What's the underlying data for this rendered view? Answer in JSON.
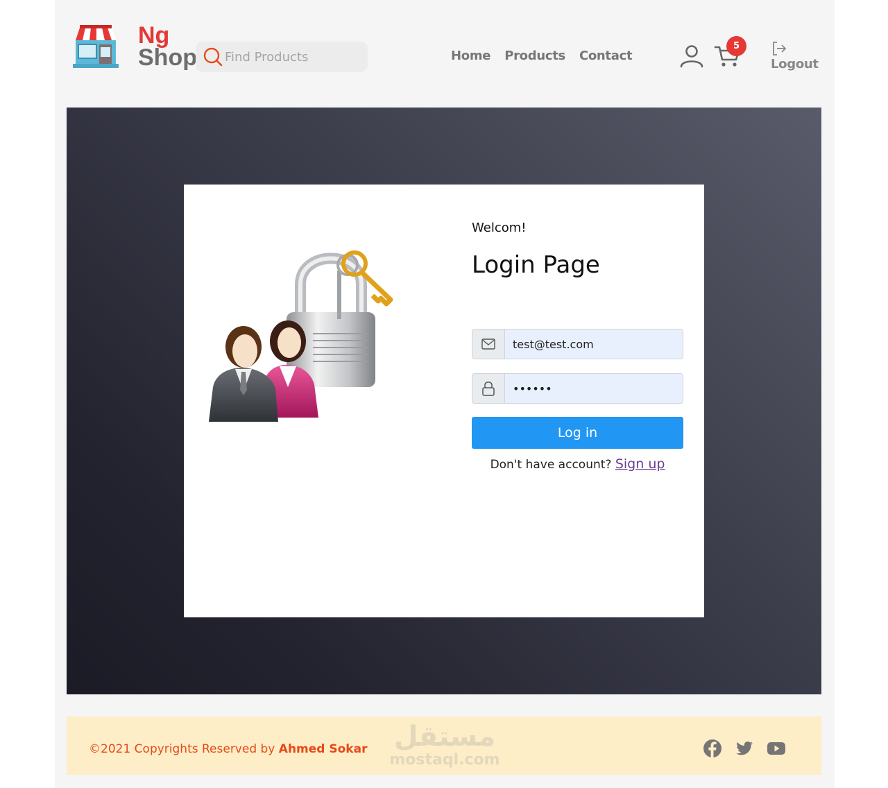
{
  "brand": {
    "line1": "Ng",
    "line2": "Shop"
  },
  "search": {
    "placeholder": "Find Products"
  },
  "nav": {
    "items": [
      "Home",
      "Products",
      "Contact"
    ]
  },
  "cart": {
    "count": "5"
  },
  "logout": {
    "label": "Logout"
  },
  "login": {
    "welcome": "Welcom!",
    "title": "Login Page",
    "email_value": "test@test.com",
    "password_value": "••••••",
    "button": "Log in",
    "no_account": "Don't have account?",
    "signup": "Sign up"
  },
  "footer": {
    "copyright": "©2021 Copyrights Reserved by",
    "author": "Ahmed Sokar",
    "watermark_ar": "مستقل",
    "watermark_en": "mostaql.com"
  },
  "icons": [
    "search-icon",
    "user-icon",
    "cart-icon",
    "logout-icon",
    "envelope-icon",
    "lock-icon",
    "facebook-icon",
    "twitter-icon",
    "youtube-icon"
  ],
  "colors": {
    "accent": "#2196f3",
    "brand_red": "#e53935",
    "footer_bg": "#fdeec8",
    "footer_text": "#e64a19"
  }
}
